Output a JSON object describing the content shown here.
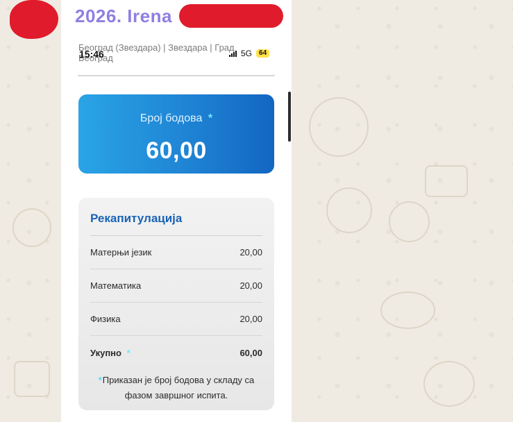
{
  "heading": {
    "title": "2026. Irena"
  },
  "location": {
    "line1": "Београд (Звездара) | Звездара | Град",
    "line2": "Београд"
  },
  "status_bar": {
    "time": "15:46",
    "network": "5G",
    "battery": "64"
  },
  "points_card": {
    "label": "Број бодова",
    "marker": "*",
    "value": "60,00"
  },
  "summary": {
    "title": "Рекапитулација",
    "rows": [
      {
        "label": "Матерњи језик",
        "value": "20,00"
      },
      {
        "label": "Математика",
        "value": "20,00"
      },
      {
        "label": "Физика",
        "value": "20,00"
      }
    ],
    "total": {
      "label": "Укупно",
      "marker": "*",
      "value": "60,00"
    },
    "note": {
      "marker": "*",
      "text": "Приказан је број бодова у складу са фазом завршног испита."
    }
  },
  "colors": {
    "title_purple": "#8f7fe2",
    "redaction_red": "#e01b2b",
    "points_gradient_start": "#2aa4e6",
    "points_gradient_end": "#1266c1",
    "summary_title_blue": "#1a63b6",
    "marker_cyan": "#71e7ff"
  }
}
